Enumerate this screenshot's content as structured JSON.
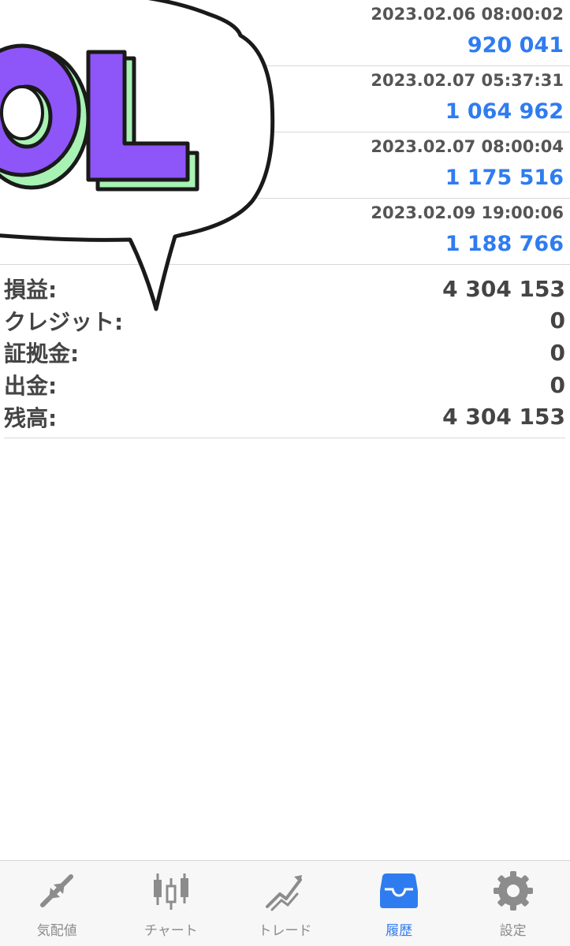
{
  "trades": [
    {
      "time": "2023.02.06 08:00:02",
      "profit": "920 041"
    },
    {
      "time": "2023.02.07 05:37:31",
      "profit": "1 064 962"
    },
    {
      "time": "2023.02.07 08:00:04",
      "profit": "1 175 516"
    },
    {
      "time": "2023.02.09 19:00:06",
      "profit": "1 188 766"
    }
  ],
  "summary": [
    {
      "label": "損益:",
      "value": "4 304 153"
    },
    {
      "label": "クレジット:",
      "value": "0"
    },
    {
      "label": "証拠金:",
      "value": "0"
    },
    {
      "label": "出金:",
      "value": "0"
    },
    {
      "label": "残高:",
      "value": "4 304 153"
    }
  ],
  "sticker": {
    "text": "LOL"
  },
  "tabs": [
    {
      "label": "気配値",
      "icon": "quotes-arrows-icon",
      "active": false
    },
    {
      "label": "チャート",
      "icon": "candlestick-chart-icon",
      "active": false
    },
    {
      "label": "トレード",
      "icon": "trade-trend-icon",
      "active": false
    },
    {
      "label": "履歴",
      "icon": "inbox-tray-icon",
      "active": true
    },
    {
      "label": "設定",
      "icon": "gear-icon",
      "active": false
    }
  ],
  "colors": {
    "accent": "#2f7cf0",
    "sticker_purple": "#8e55f8",
    "sticker_green": "#a8f2b4"
  }
}
